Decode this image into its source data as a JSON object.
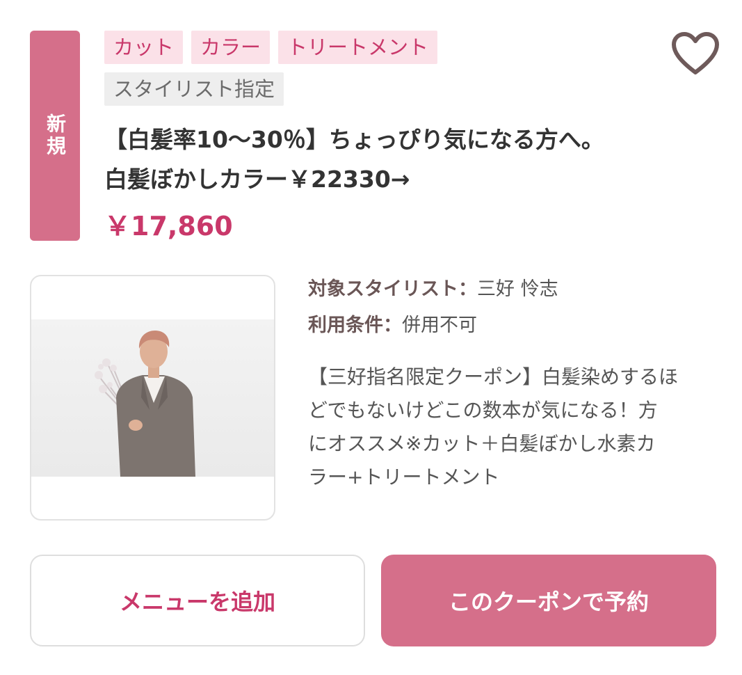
{
  "badge": {
    "label": "新規"
  },
  "tags": {
    "row1": [
      "カット",
      "カラー",
      "トリートメント"
    ],
    "row2": [
      "スタイリスト指定"
    ]
  },
  "favorite": {
    "icon": "heart-outline-icon"
  },
  "coupon": {
    "title_line1": "【白髪率10〜30％】ちょっぴり気になる方へ。",
    "title_line2": "白髪ぼかしカラー￥22330→",
    "price": "￥17,860"
  },
  "details": {
    "stylist_label": "対象スタイリスト：",
    "stylist_value": "三好 怜志",
    "condition_label": "利用条件：",
    "condition_value": "併用不可",
    "description_lines": [
      "【三好指名限定クーポン】白髪染めするほ",
      "どでもないけどこの数本が気になる！方",
      "にオススメ※カット＋白髪ぼかし水素カ",
      "ラー+トリートメント"
    ]
  },
  "buttons": {
    "add_menu": "メニューを追加",
    "reserve": "このクーポンで予約"
  },
  "colors": {
    "accent": "#d56f8a",
    "accent_text": "#c9386a",
    "tag_pink_bg": "#fbe1e8",
    "tag_gray_bg": "#eeeeee"
  }
}
